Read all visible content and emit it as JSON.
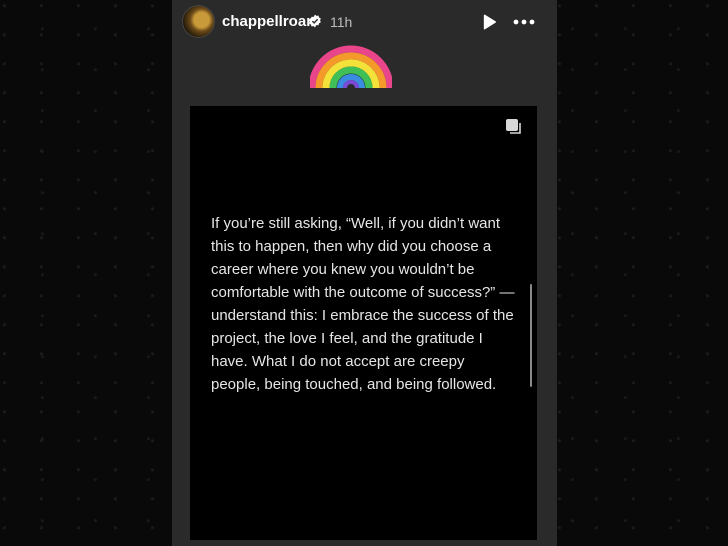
{
  "header": {
    "username": "chappellroan",
    "timestamp": "11h",
    "icons": {
      "avatar": "profile-avatar",
      "verified": "verified-badge-icon",
      "play": "play-icon",
      "more": "more-options-icon"
    }
  },
  "sticker": {
    "name": "glitter-rainbow-sticker",
    "colors": [
      "#e8458b",
      "#f39a2b",
      "#f4e23a",
      "#3fbf55",
      "#3a8de0",
      "#7a4ad6"
    ]
  },
  "post": {
    "icon": "carousel-copy-icon",
    "text": "If you’re still asking, “Well, if you didn’t want this to happen, then why did you choose a career where you knew you wouldn’t be comfortable with the outcome of success?” —understand this: I embrace the success of the project, the love I feel, and the gratitude I have. What I do not accept are creepy people, being touched, and being followed."
  },
  "colors": {
    "panel": "#2a2a2a",
    "card": "#000000",
    "text": "#e6e6e6",
    "subtle": "#bdbdbd"
  }
}
